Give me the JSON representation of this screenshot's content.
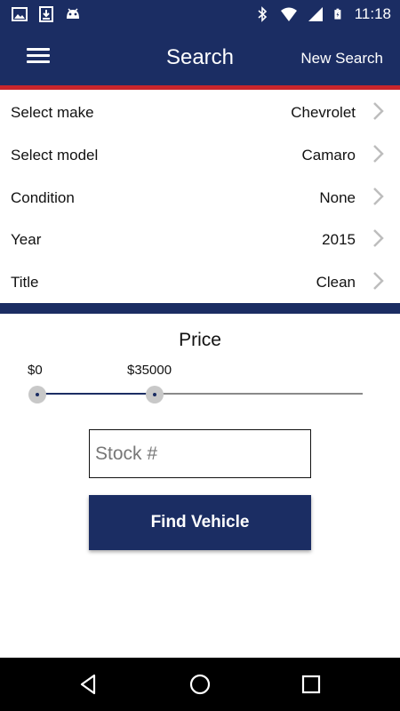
{
  "status_bar": {
    "time": "11:18",
    "left_icons": [
      "image-icon",
      "download-icon",
      "android-icon"
    ],
    "right_icons": [
      "bluetooth-icon",
      "wifi-icon",
      "signal-icon",
      "battery-icon"
    ]
  },
  "app_bar": {
    "menu_icon": "hamburger-menu-icon",
    "title": "Search",
    "new_search": "New Search"
  },
  "filters": [
    {
      "label": "Select make",
      "value": "Chevrolet"
    },
    {
      "label": "Select model",
      "value": "Camaro"
    },
    {
      "label": "Condition",
      "value": "None"
    },
    {
      "label": "Year",
      "value": "2015"
    },
    {
      "label": "Title",
      "value": "Clean"
    }
  ],
  "price": {
    "title": "Price",
    "min_label": "$0",
    "max_label": "$35000",
    "low_fraction": 0.0,
    "high_fraction": 0.36
  },
  "stock": {
    "placeholder": "Stock #",
    "value": ""
  },
  "find_button": "Find Vehicle",
  "nav": [
    "back-icon",
    "home-icon",
    "recents-icon"
  ],
  "colors": {
    "primary": "#1b2d63",
    "accent_stripe": "#c9252c"
  }
}
